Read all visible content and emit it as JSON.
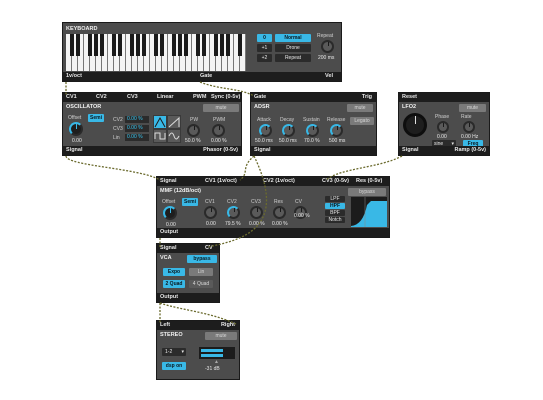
{
  "keyboard": {
    "title": "KEYBOARD",
    "octave_value": "0",
    "plus1": "+1",
    "plus2": "+2",
    "mode_normal": "Normal",
    "mode_drone": "Drone",
    "mode_repeat": "Repeat",
    "repeat_label": "Repeat",
    "repeat_value": "200 ms",
    "out_left": "1v/oct",
    "out_mid": "Gate",
    "out_right": "Vel"
  },
  "oscillator": {
    "inputs": [
      "CV1",
      "CV2",
      "CV3",
      "Linear",
      "PWM",
      "Sync (0-5v)"
    ],
    "title": "OSCILLATOR",
    "mute": "mute",
    "offset_label": "Offset",
    "semi": "Semi",
    "offset_value": "0.00",
    "cv2_label": "CV2",
    "cv3_label": "CV3",
    "lin_label": "Lin",
    "cv2_value": "0.00 %",
    "cv3_value": "0.00 %",
    "lin_value": "0.00 %",
    "pw_label": "PW",
    "pwm_label": "PWM",
    "pw_value": "50.0 %",
    "pwm_value": "0.00 %",
    "out_left": "Signal",
    "out_right": "Phasor (0-5v)"
  },
  "adsr": {
    "in_left": "Gate",
    "in_right": "Trig",
    "title": "ADSR",
    "mute": "mute",
    "attack_label": "Attack",
    "decay_label": "Decay",
    "sustain_label": "Sustain",
    "release_label": "Release",
    "attack_value": "50.0 ms",
    "decay_value": "50.0 ms",
    "sustain_value": "70.0 %",
    "release_value": "500 ms",
    "legato": "Legato",
    "out_left": "Signal"
  },
  "lfo2": {
    "in_left": "Reset",
    "title": "LFO2",
    "mute": "mute",
    "phase_label": "Phase",
    "rate_label": "Rate",
    "phase_value": "0.00",
    "rate_value": "0.00 Hz",
    "wave": "sine",
    "freq": "Freq",
    "out_left": "Signal",
    "out_right": "Ramp (0-5v)"
  },
  "mmf": {
    "inputs": [
      "Signal",
      "CV1 (1v/oct)",
      "CV2 (1v/oct)",
      "CV3 (0-5v)",
      "Res (0-5v)"
    ],
    "title": "MMF (12dB/oct)",
    "bypass": "bypass",
    "offset_label": "Offset",
    "semi": "Semi",
    "offset_value": "0.00",
    "cv1_label": "CV1",
    "cv2_label": "CV2",
    "cv3_label": "CV3",
    "res_label": "Res",
    "cv_label": "CV",
    "cv1_value": "0.00",
    "cv2_value": "79.5 %",
    "cv3_value": "0.00 %",
    "res_value": "0.00 %",
    "cv_value": "0.00 %",
    "filters": [
      "LPF",
      "HPF",
      "BPF",
      "Notch"
    ],
    "out_left": "Output"
  },
  "vca": {
    "in_left": "Signal",
    "in_right": "CV",
    "title": "VCA",
    "bypass": "bypass",
    "expo": "Expo",
    "lin": "Lin",
    "quad2": "2 Quad",
    "quad4": "4 Quad",
    "out_left": "Output"
  },
  "stereo": {
    "in_left": "Left",
    "in_right": "Right",
    "title": "STEREO",
    "mute": "mute",
    "channel": "1-2",
    "dsp": "dsp on",
    "level_value": "-31 dB"
  },
  "colors": {
    "accent": "#39b8e6",
    "panel": "#4c4c4c",
    "bar": "#1d1d1d",
    "cable": "#6b6b2e"
  }
}
